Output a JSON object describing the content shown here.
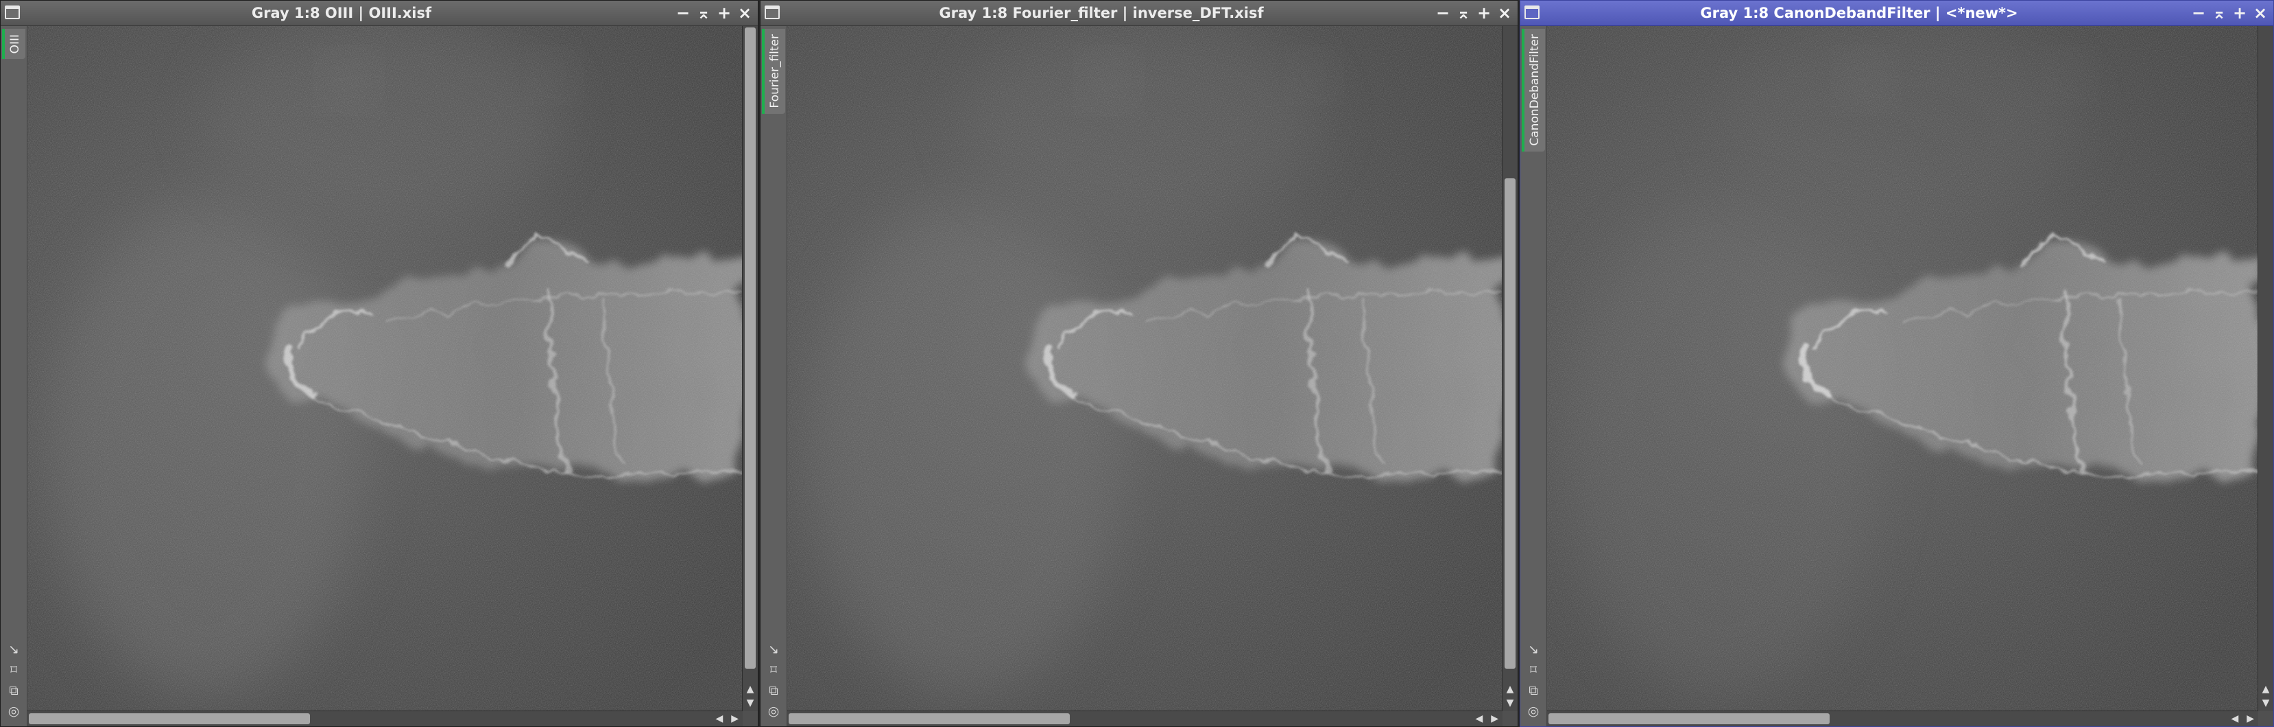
{
  "windows": [
    {
      "title": "Gray 1:8 OIII | OIII.xisf",
      "tab_label": "OIII",
      "active": false
    },
    {
      "title": "Gray 1:8 Fourier_filter | inverse_DFT.xisf",
      "tab_label": "Fourier_filter",
      "active": false
    },
    {
      "title": "Gray 1:8 CanonDebandFilter | <*new*>",
      "tab_label": "CanonDebandFilter",
      "active": true
    }
  ],
  "controls": {
    "minimize": "−",
    "shade": "⌅",
    "maximize": "+",
    "close": "×"
  },
  "side_icons": {
    "pointer": "↘",
    "zoom_fit": "⌑",
    "clone": "⧉",
    "target": "◎"
  },
  "scroll_arrows": {
    "up": "▲",
    "down": "▼",
    "left": "◀",
    "right": "▶"
  },
  "colors": {
    "active_titlebar": "#5a62c2",
    "inactive_titlebar": "#5e5e5e",
    "tab_marker": "#1fae4e"
  }
}
